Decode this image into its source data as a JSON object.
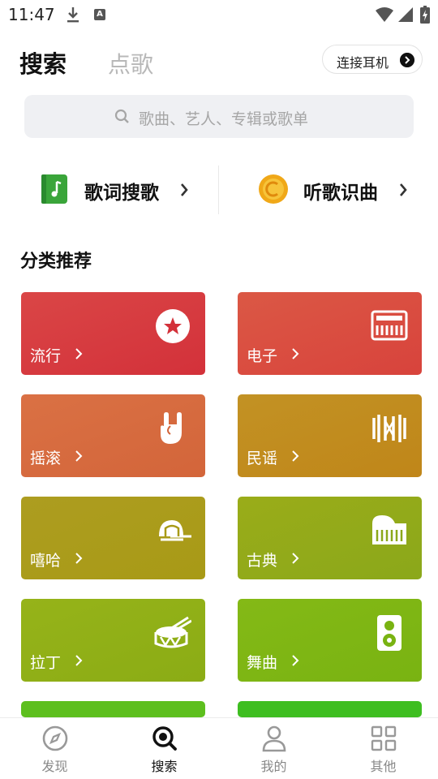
{
  "status_bar": {
    "time": "11:47",
    "input_badge": "A"
  },
  "header": {
    "tab_search": "搜索",
    "tab_order": "点歌",
    "connect_label": "连接耳机"
  },
  "search": {
    "placeholder": "歌曲、艺人、专辑或歌单"
  },
  "quick_actions": {
    "lyric_search": "歌词搜歌",
    "listen_identify": "听歌识曲"
  },
  "categories_title": "分类推荐",
  "categories": [
    {
      "label": "流行",
      "icon": "star-icon",
      "color_top": "#da4646",
      "color_bottom": "#d3313a"
    },
    {
      "label": "电子",
      "icon": "synth-keyboard-icon",
      "color_top": "#db5845",
      "color_bottom": "#d8433c"
    },
    {
      "label": "摇滚",
      "icon": "rock-hand-icon",
      "color_top": "#da7144",
      "color_bottom": "#d3653a"
    },
    {
      "label": "民谣",
      "icon": "harmonica-icon",
      "color_top": "#c29224",
      "color_bottom": "#c08619"
    },
    {
      "label": "嘻哈",
      "icon": "cap-icon",
      "color_top": "#ad9d20",
      "color_bottom": "#a89a16"
    },
    {
      "label": "古典",
      "icon": "piano-icon",
      "color_top": "#9aac19",
      "color_bottom": "#8ba81a"
    },
    {
      "label": "拉丁",
      "icon": "drum-icon",
      "color_top": "#96b319",
      "color_bottom": "#8bac15"
    },
    {
      "label": "舞曲",
      "icon": "speaker-icon",
      "color_top": "#84b916",
      "color_bottom": "#79b312"
    }
  ],
  "partial_row_colors": [
    "#5dbf1e",
    "#3ebe20"
  ],
  "bottom_nav": [
    {
      "label": "发现",
      "icon": "compass-icon"
    },
    {
      "label": "搜索",
      "icon": "search-icon",
      "active": true
    },
    {
      "label": "我的",
      "icon": "person-icon"
    },
    {
      "label": "其他",
      "icon": "grid-icon"
    }
  ]
}
